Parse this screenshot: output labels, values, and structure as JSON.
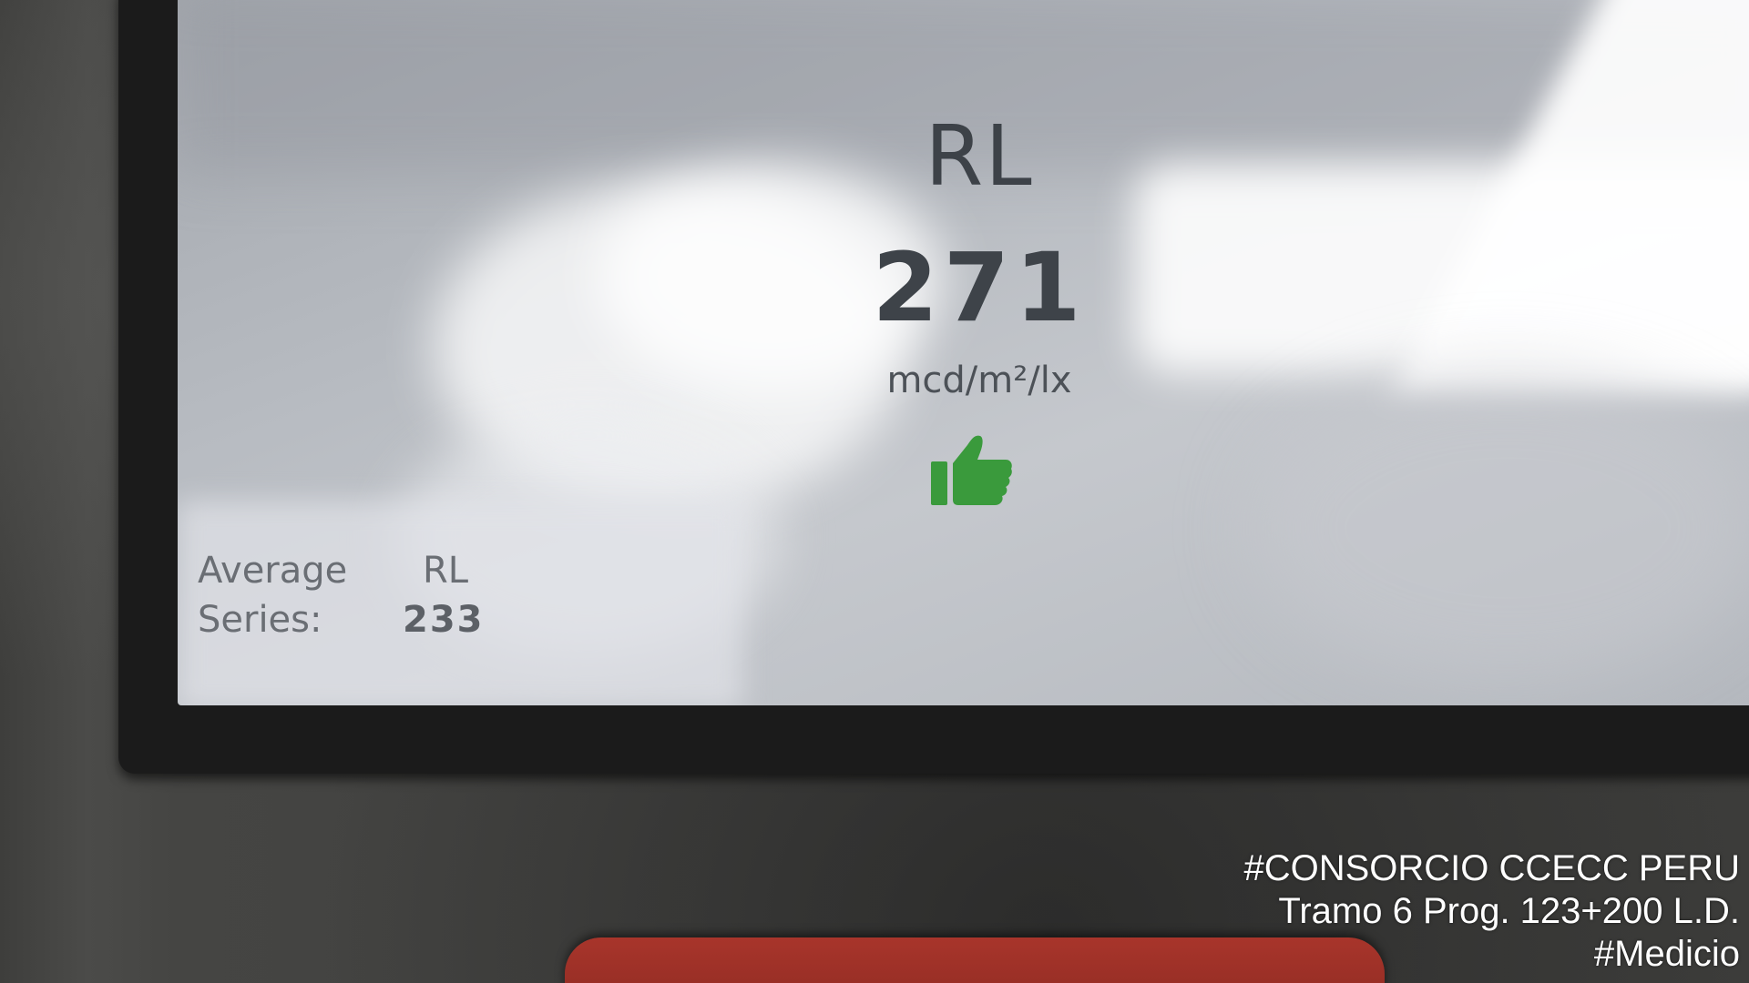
{
  "display": {
    "measurement_label": "RL",
    "measurement_value": "271",
    "unit": "mcd/m²/lx",
    "result_icon": "thumbs-up-icon",
    "result_color": "#3a9a3c"
  },
  "average": {
    "label_line1": "Average",
    "label_line2": "Series:",
    "metric": "RL",
    "value": "233"
  },
  "watermark": {
    "line1": "#CONSORCIO CCECC PERU",
    "line2": "Tramo 6 Prog. 123+200 L.D.",
    "line3": "#Medicio"
  }
}
